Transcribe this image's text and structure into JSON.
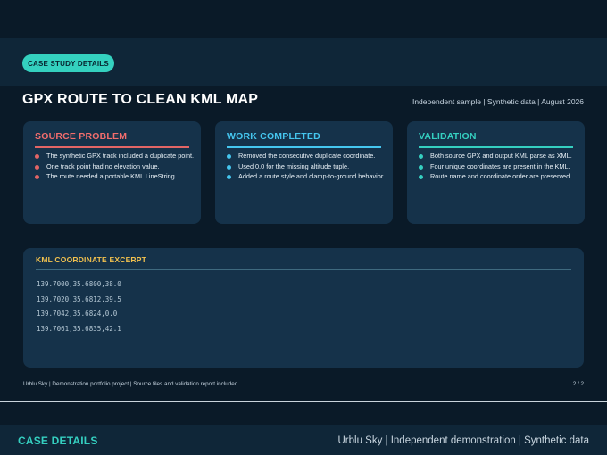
{
  "header": {
    "badge": "CASE STUDY DETAILS",
    "title": "GPX ROUTE TO CLEAN KML MAP",
    "subtitle": "Independent sample | Synthetic data | August 2026"
  },
  "cards": [
    {
      "title": "SOURCE PROBLEM",
      "accent": "#e26565",
      "items": [
        "The synthetic GPX track included a duplicate point.",
        "One track point had no elevation value.",
        "The route needed a portable KML LineString."
      ]
    },
    {
      "title": "WORK COMPLETED",
      "accent": "#45c6ef",
      "items": [
        "Removed the consecutive duplicate coordinate.",
        "Used 0.0 for the missing altitude tuple.",
        "Added a route style and clamp-to-ground behavior."
      ]
    },
    {
      "title": "VALIDATION",
      "accent": "#35cfc0",
      "items": [
        "Both source GPX and output KML parse as XML.",
        "Four unique coordinates are present in the KML.",
        "Route name and coordinate order are preserved."
      ]
    }
  ],
  "excerpt": {
    "title": "KML COORDINATE EXCERPT",
    "lines": [
      "139.7000,35.6800,38.0",
      "139.7020,35.6812,39.5",
      "139.7042,35.6824,0.0",
      "139.7061,35.6835,42.1"
    ]
  },
  "footer": {
    "note": "Urblu Sky | Demonstration portfolio project | Source files and validation report included",
    "page": "2 / 2"
  },
  "bottom_bar": {
    "left": "CASE DETAILS",
    "right": "Urblu Sky | Independent demonstration | Synthetic data"
  },
  "colors": {
    "background": "#0a1a28",
    "panel": "#15324a",
    "teal": "#35cfc0",
    "blue": "#45c6ef",
    "red": "#e26565",
    "gold": "#f2c14e"
  }
}
